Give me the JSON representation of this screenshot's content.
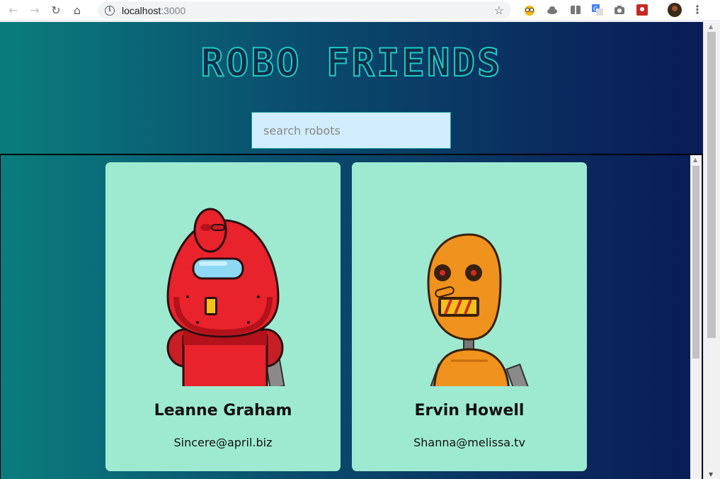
{
  "browser": {
    "url_host": "localhost",
    "url_port": ":3000",
    "info_icon": "i",
    "star_icon": "☆",
    "menu_icon": "⋮",
    "back_icon": "←",
    "forward_icon": "→",
    "reload_icon": "↻",
    "home_icon": "⌂"
  },
  "app": {
    "title": "ROBO FRIENDS",
    "search_placeholder": "search robots",
    "search_value": ""
  },
  "robots": [
    {
      "name": "Leanne Graham",
      "email": "Sincere@april.biz",
      "color": "#e8232c"
    },
    {
      "name": "Ervin Howell",
      "email": "Shanna@melissa.tv",
      "color": "#f0921e"
    }
  ]
}
